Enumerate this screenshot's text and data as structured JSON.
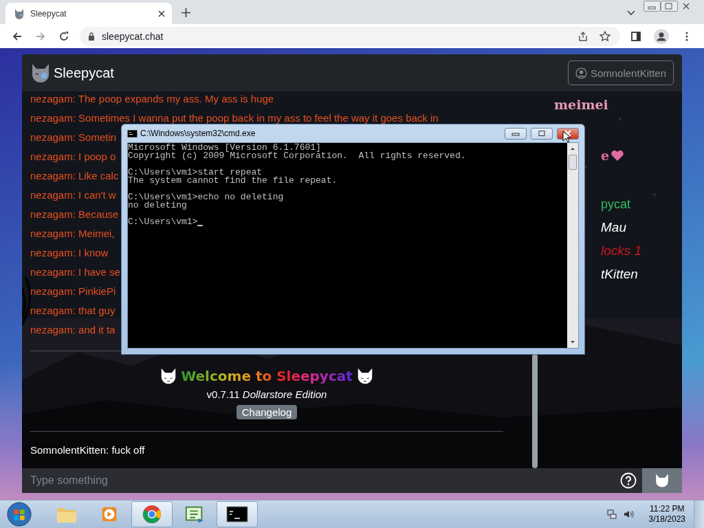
{
  "browser": {
    "tabs": [
      {
        "title": "Sleepycat",
        "selected": true
      }
    ],
    "url": "sleepycat.chat"
  },
  "app": {
    "title": "Sleepycat",
    "account": "SomnolentKitten",
    "messages": [
      {
        "text": "nezagam: The poop expands my ass. My ass is huge"
      },
      {
        "text": "nezagam: Sometimes I wanna put the poop back in my ass to feel the way it goes back in"
      },
      {
        "text": "nezagam: Sometin"
      },
      {
        "text": "nezagam: I poop o"
      },
      {
        "text": "nezagam: Like calc"
      },
      {
        "text": "nezagam: I can't w"
      },
      {
        "text": "nezagam: Because"
      },
      {
        "text": "nezagam: Meimei,"
      },
      {
        "text": "nezagam: I know"
      },
      {
        "text": "nezagam: I have se"
      },
      {
        "text": "nezagam: PinkiePi"
      },
      {
        "text": "nezagam: that guy"
      },
      {
        "text": "nezagam: and it ta"
      }
    ],
    "welcome": {
      "title": "Welcome to Sleepycat",
      "version": "v0.7.11 *Dollarstore Edition*",
      "button": "Changelog"
    },
    "last_message": "SomnolentKitten: fuck off",
    "input": {
      "placeholder": "Type something"
    },
    "users": [
      {
        "name": "meimei",
        "kind": "fancy",
        "color": "#e59ab4",
        "heart": false
      },
      {
        "name": "e",
        "kind": "fancy",
        "color": "#e26aa2",
        "heart": true
      },
      {
        "name": "pycat",
        "kind": "plain",
        "color": "#2fbf63",
        "heart": false
      },
      {
        "name": "Mau",
        "kind": "italic",
        "color": "#ffffff",
        "heart": false
      },
      {
        "name": "locks 1",
        "kind": "italic",
        "color": "#d0141e",
        "heart": false
      },
      {
        "name": "tKitten",
        "kind": "italic",
        "color": "#ffffff",
        "heart": false
      }
    ]
  },
  "console": {
    "title": "C:\\Windows\\system32\\cmd.exe",
    "blocks": [
      [
        "Microsoft Windows [Version 6.1.7601]",
        "Copyright (c) 2009 Microsoft Corporation.  All rights reserved."
      ],
      [
        "C:\\Users\\vm1>start repeat",
        "The system cannot find the file repeat."
      ],
      [
        "C:\\Users\\vm1>echo no deleting",
        "no deleting"
      ],
      [
        "C:\\Users\\vm1>"
      ]
    ]
  },
  "taskbar": {
    "items": [
      {
        "kind": "folder",
        "selected": false
      },
      {
        "kind": "media",
        "selected": false
      },
      {
        "kind": "chrome",
        "selected": true
      },
      {
        "kind": "csharp",
        "selected": false
      },
      {
        "kind": "console",
        "selected": true
      }
    ],
    "time": "11:22 PM",
    "date": "3/18/2023"
  }
}
